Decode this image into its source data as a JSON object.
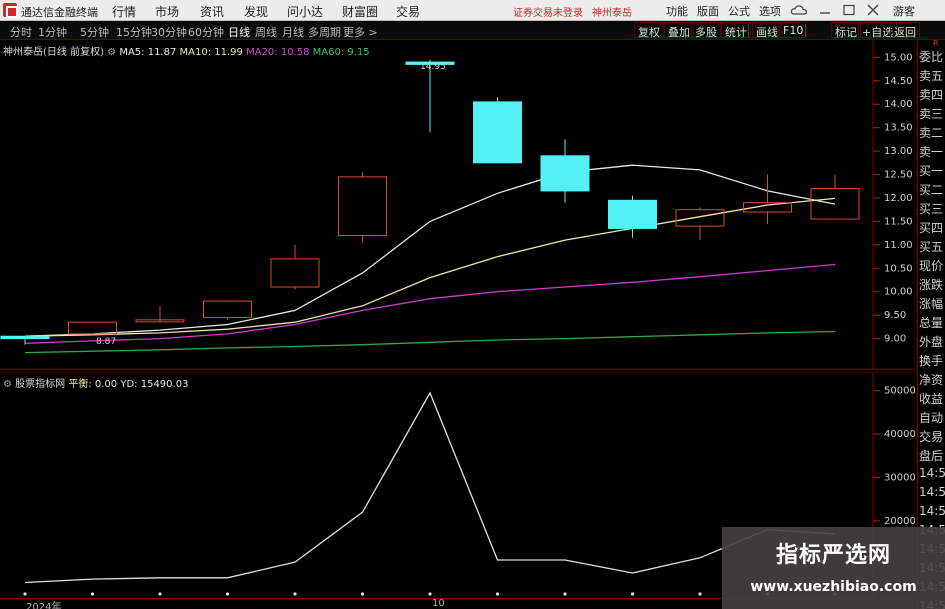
{
  "menubar": {
    "app_title": "通达信金融终端",
    "items": [
      "行情",
      "市场",
      "资讯",
      "发现",
      "问小达",
      "财富圈",
      "交易"
    ],
    "notice": "证券交易未登录",
    "stock": "神州泰岳",
    "right_items": [
      "功能",
      "版面",
      "公式",
      "选项"
    ],
    "guest": "游客"
  },
  "toolbar": {
    "periods": [
      "分时",
      "1分钟",
      "5分钟",
      "15分钟",
      "30分钟",
      "60分钟",
      "日线",
      "周线",
      "月线",
      "多周期",
      "更多 >"
    ],
    "active_period": "日线",
    "buttons": [
      "复权",
      "叠加",
      "多股",
      "统计",
      "画线",
      "F10",
      "标记",
      "+自选",
      "返回"
    ]
  },
  "main_chart": {
    "stock_label": "神州泰岳",
    "mode": "(日线 前复权)",
    "ma5": "MA5: 11.87",
    "ma10": "MA10: 11.99",
    "ma20": "MA20: 10.58",
    "ma60": "MA60: 9.15",
    "high_label": "14.95",
    "low_label": "8.87"
  },
  "sub_chart": {
    "name": "股票指标网",
    "balance": "平衡: 0.00",
    "yd": "YD: 15490.03"
  },
  "date_axis": {
    "start": "2024年",
    "mid": "10"
  },
  "right_panel": {
    "top_label": "R",
    "labels": [
      "委比",
      "卖五",
      "卖四",
      "卖三",
      "卖二",
      "卖一",
      "买一",
      "买二",
      "买三",
      "买四",
      "买五",
      "现价",
      "涨跌",
      "涨幅",
      "总量",
      "外盘",
      "换手",
      "净资",
      "收益",
      "自动",
      "交易",
      "盘后",
      "14:5",
      "14:5",
      "14:5",
      "14:5",
      "14:5",
      "14:5",
      "14:5",
      "14:5"
    ]
  },
  "watermark": {
    "line1": "指标严选网",
    "line2": "www.xuezhibiao.com"
  },
  "colors": {
    "bull": "#e0453a",
    "bear": "#54f0f5",
    "ma5": "#e8e8e8",
    "ma10": "#e8e6a8",
    "ma20": "#cc3ccc",
    "ma60": "#2ea84e",
    "menu_red": "#d8232a"
  },
  "chart_data": [
    {
      "type": "candlestick",
      "title": "",
      "ylim": [
        8.5,
        15.2
      ],
      "yticks": [
        9.0,
        9.5,
        10.0,
        10.5,
        11.0,
        11.5,
        12.0,
        12.5,
        13.0,
        13.5,
        14.0,
        14.5,
        15.0
      ],
      "candles": [
        {
          "o": 9.05,
          "c": 9.0,
          "h": 9.05,
          "l": 8.87
        },
        {
          "o": 9.1,
          "c": 9.35,
          "h": 9.35,
          "l": 9.08
        },
        {
          "o": 9.4,
          "c": 9.4,
          "h": 9.7,
          "l": 9.35
        },
        {
          "o": 9.45,
          "c": 9.8,
          "h": 9.82,
          "l": 9.4
        },
        {
          "o": 10.1,
          "c": 10.7,
          "h": 11.0,
          "l": 10.05
        },
        {
          "o": 11.2,
          "c": 12.45,
          "h": 12.55,
          "l": 11.05
        },
        {
          "o": 14.9,
          "c": 14.85,
          "h": 14.95,
          "l": 13.4
        },
        {
          "o": 14.05,
          "c": 12.75,
          "h": 14.15,
          "l": 12.75
        },
        {
          "o": 12.9,
          "c": 12.15,
          "h": 13.25,
          "l": 11.9
        },
        {
          "o": 11.95,
          "c": 11.35,
          "h": 12.05,
          "l": 11.15
        },
        {
          "o": 11.4,
          "c": 11.75,
          "h": 11.8,
          "l": 11.1
        },
        {
          "o": 11.7,
          "c": 11.9,
          "h": 12.5,
          "l": 11.45
        },
        {
          "o": 11.55,
          "c": 12.2,
          "h": 12.5,
          "l": 11.55
        }
      ],
      "ma": [
        {
          "name": "MA5",
          "values": [
            9.05,
            9.1,
            9.18,
            9.3,
            9.6,
            10.4,
            11.5,
            12.1,
            12.55,
            12.7,
            12.6,
            12.15,
            11.87
          ]
        },
        {
          "name": "MA10",
          "values": [
            9.05,
            9.08,
            9.12,
            9.2,
            9.35,
            9.7,
            10.3,
            10.75,
            11.1,
            11.35,
            11.6,
            11.85,
            11.99
          ]
        },
        {
          "name": "MA20",
          "values": [
            8.9,
            8.95,
            9.0,
            9.1,
            9.3,
            9.6,
            9.85,
            10.0,
            10.1,
            10.2,
            10.32,
            10.45,
            10.58
          ]
        },
        {
          "name": "MA60",
          "values": [
            8.7,
            8.73,
            8.76,
            8.8,
            8.83,
            8.87,
            8.92,
            8.97,
            9.0,
            9.04,
            9.08,
            9.12,
            9.15
          ]
        }
      ]
    },
    {
      "type": "line",
      "title": "股票指标网",
      "ylim": [
        5000,
        52000
      ],
      "yticks": [
        50000,
        40000,
        30000,
        20000
      ],
      "series": [
        {
          "name": "",
          "values": [
            5800,
            6600,
            6900,
            6900,
            10500,
            22000,
            49500,
            11000,
            11000,
            8000,
            11500,
            18000,
            17000
          ]
        }
      ]
    }
  ]
}
